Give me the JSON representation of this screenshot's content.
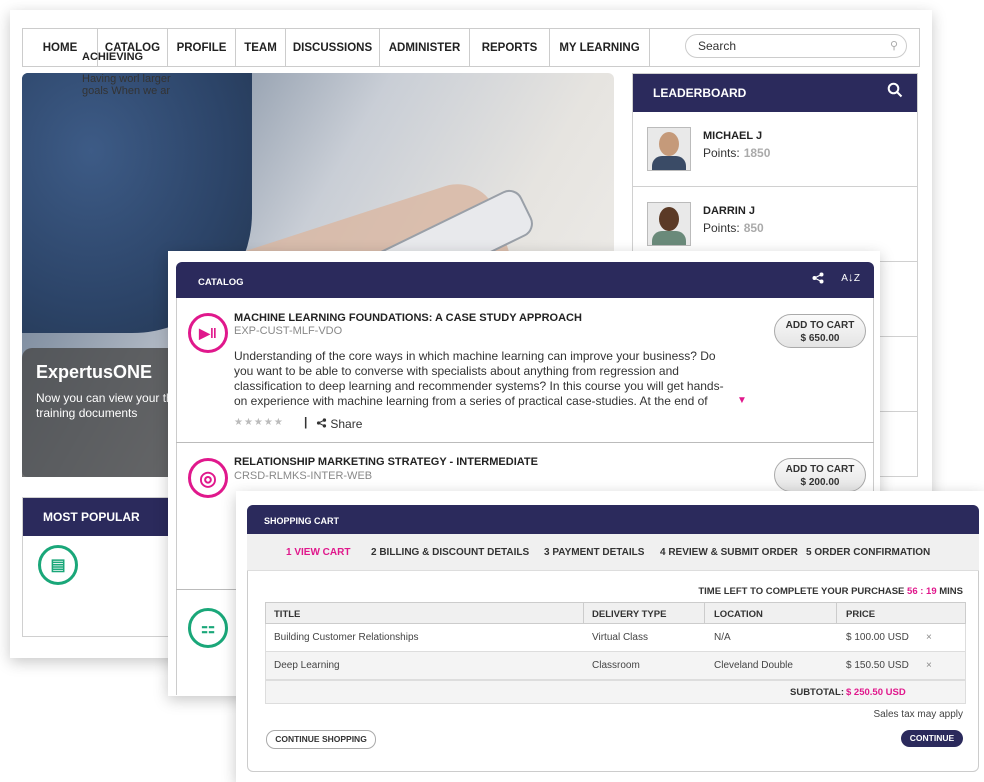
{
  "nav": {
    "items": [
      "HOME",
      "CATALOG",
      "PROFILE",
      "TEAM",
      "DISCUSSIONS",
      "ADMINISTER",
      "REPORTS",
      "MY LEARNING"
    ],
    "search_placeholder": "Search"
  },
  "hero": {
    "title": "ExpertusONE",
    "text": "Now you can view your the training documents"
  },
  "leaderboard": {
    "title": "LEADERBOARD",
    "points_label": "Points:",
    "entries": [
      {
        "name": "MICHAEL J",
        "points": "1850"
      },
      {
        "name": "DARRIN J",
        "points": "850"
      }
    ]
  },
  "most_popular": {
    "title": "MOST POPULAR",
    "item_title": "ACHIEVING",
    "item_text": "Having worl larger goals When we ar"
  },
  "catalog": {
    "title": "CATALOG",
    "items": [
      {
        "title": "MACHINE LEARNING FOUNDATIONS: A CASE STUDY APPROACH",
        "code": "EXP-CUST-MLF-VDO",
        "description": "Understanding of the core ways in which machine learning can improve your business? Do you want to be able to converse with specialists about anything from regression and classification to deep learning and recommender systems? In this course you will get hands-on experience with machine learning from a series of practical case-studies. At the end of",
        "rating": "★★★★★",
        "share_label": "Share",
        "button_label": "ADD TO CART",
        "price": "$ 650.00"
      },
      {
        "title": "RELATIONSHIP MARKETING STRATEGY - INTERMEDIATE",
        "code": "CRSD-RLMKS-INTER-WEB",
        "button_label": "ADD TO CART",
        "price": "$ 200.00"
      }
    ]
  },
  "cart": {
    "title": "SHOPPING CART",
    "steps": [
      "1 VIEW CART",
      "2 BILLING & DISCOUNT DETAILS",
      "3 PAYMENT DETAILS",
      "4 REVIEW & SUBMIT ORDER",
      "5 ORDER CONFIRMATION"
    ],
    "timer_label": "TIME LEFT TO COMPLETE YOUR PURCHASE",
    "timer_value": "56 : 19",
    "timer_unit": "MINS",
    "columns": [
      "TITLE",
      "DELIVERY TYPE",
      "LOCATION",
      "PRICE"
    ],
    "rows": [
      {
        "title": "Building Customer Relationships",
        "delivery": "Virtual Class",
        "location": "N/A",
        "price": "$ 100.00 USD",
        "remove": "×"
      },
      {
        "title": "Deep Learning",
        "delivery": "Classroom",
        "location": "Cleveland Double",
        "price": "$ 150.50 USD",
        "remove": "×"
      }
    ],
    "subtotal_label": "SUBTOTAL:",
    "subtotal_value": "$ 250.50 USD",
    "tax_note": "Sales tax may apply",
    "continue_shopping": "CONTINUE SHOPPING",
    "continue": "CONTINUE"
  },
  "colors": {
    "header_navy": "#2b2a5c",
    "accent_magenta": "#e0188c",
    "accent_green": "#1aa779"
  }
}
